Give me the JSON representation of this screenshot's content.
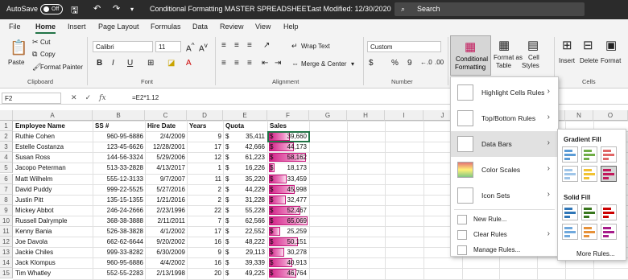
{
  "titlebar": {
    "autosave_label": "AutoSave",
    "autosave_state": "Off",
    "title": "Conditional Formatting MASTER SPREADSHEET",
    "last_modified": "Last Modified: 12/30/2020",
    "search_placeholder": "Search"
  },
  "tabs": [
    "File",
    "Home",
    "Insert",
    "Page Layout",
    "Formulas",
    "Data",
    "Review",
    "View",
    "Help"
  ],
  "ribbon": {
    "paste": "Paste",
    "cut": "Cut",
    "copy": "Copy",
    "format_painter": "Format Painter",
    "clipboard": "Clipboard",
    "font_name": "Calibri",
    "font_size": "11",
    "font_group": "Font",
    "wrap_text": "Wrap Text",
    "merge_center": "Merge & Center",
    "alignment": "Alignment",
    "number_format": "Custom",
    "number": "Number",
    "cond_fmt_1": "Conditional",
    "cond_fmt_2": "Formatting",
    "format_as_table_1": "Format as",
    "format_as_table_2": "Table",
    "cell_styles_1": "Cell",
    "cell_styles_2": "Styles",
    "insert": "Insert",
    "delete": "Delete",
    "format": "Format",
    "cells": "Cells"
  },
  "formula_bar": {
    "name_box": "F2",
    "formula": "=E2*1.12"
  },
  "columns": [
    "A",
    "B",
    "C",
    "D",
    "E",
    "F",
    "G",
    "H",
    "I",
    "J",
    "K",
    "L",
    "M",
    "N",
    "O"
  ],
  "headers": {
    "A": "Employee Name",
    "B": "SS #",
    "C": "Hire Date",
    "D": "Years",
    "E": "Quota",
    "F": "Sales"
  },
  "rows": [
    {
      "n": "2",
      "name": "Ruthie Cohen",
      "ss": "960-95-6886",
      "hire": "2/4/2009",
      "years": "9",
      "quota": "35,411",
      "sales": "39,660",
      "fill": 0.55
    },
    {
      "n": "3",
      "name": "Estelle Costanza",
      "ss": "123-45-6626",
      "hire": "12/28/2001",
      "years": "17",
      "quota": "42,666",
      "sales": "44,173",
      "fill": 0.65
    },
    {
      "n": "4",
      "name": "Susan Ross",
      "ss": "144-56-3324",
      "hire": "5/29/2006",
      "years": "12",
      "quota": "61,223",
      "sales": "58,162",
      "fill": 0.95
    },
    {
      "n": "5",
      "name": "Jacopo Peterman",
      "ss": "513-33-2828",
      "hire": "4/13/2017",
      "years": "1",
      "quota": "16,226",
      "sales": "18,173",
      "fill": 0.15
    },
    {
      "n": "6",
      "name": "Matt Wilhelm",
      "ss": "555-12-3133",
      "hire": "9/7/2007",
      "years": "11",
      "quota": "35,220",
      "sales": "33,459",
      "fill": 0.45
    },
    {
      "n": "7",
      "name": "David Puddy",
      "ss": "999-22-5525",
      "hire": "5/27/2016",
      "years": "2",
      "quota": "44,229",
      "sales": "45,998",
      "fill": 0.67
    },
    {
      "n": "8",
      "name": "Justin Pitt",
      "ss": "135-15-1355",
      "hire": "1/21/2016",
      "years": "2",
      "quota": "31,228",
      "sales": "32,477",
      "fill": 0.44
    },
    {
      "n": "9",
      "name": "Mickey Abbot",
      "ss": "246-24-2666",
      "hire": "2/23/1996",
      "years": "22",
      "quota": "55,228",
      "sales": "52,467",
      "fill": 0.82
    },
    {
      "n": "10",
      "name": "Russell Dalrymple",
      "ss": "368-38-3888",
      "hire": "2/11/2011",
      "years": "7",
      "quota": "62,566",
      "sales": "65,069",
      "fill": 1.0
    },
    {
      "n": "11",
      "name": "Kenny Bania",
      "ss": "526-38-3828",
      "hire": "4/1/2002",
      "years": "17",
      "quota": "22,552",
      "sales": "25,259",
      "fill": 0.3
    },
    {
      "n": "12",
      "name": "Joe Davola",
      "ss": "662-62-6644",
      "hire": "9/20/2002",
      "years": "16",
      "quota": "48,222",
      "sales": "50,151",
      "fill": 0.75
    },
    {
      "n": "13",
      "name": "Jackie Chiles",
      "ss": "999-33-8282",
      "hire": "6/30/2009",
      "years": "9",
      "quota": "29,113",
      "sales": "30,278",
      "fill": 0.4
    },
    {
      "n": "14",
      "name": "Jack Klompus",
      "ss": "960-95-6886",
      "hire": "4/4/2002",
      "years": "16",
      "quota": "39,339",
      "sales": "40,913",
      "fill": 0.6
    },
    {
      "n": "15",
      "name": "Tim Whatley",
      "ss": "552-55-2283",
      "hire": "2/13/1998",
      "years": "20",
      "quota": "49,225",
      "sales": "46,764",
      "fill": 0.7
    }
  ],
  "cf_menu": {
    "highlight": "Highlight Cells Rules",
    "topbottom": "Top/Bottom Rules",
    "databars": "Data Bars",
    "colorscales": "Color Scales",
    "iconsets": "Icon Sets",
    "newrule": "New Rule...",
    "clearrules": "Clear Rules",
    "managerules": "Manage Rules..."
  },
  "databars_menu": {
    "gradient": "Gradient Fill",
    "solid": "Solid Fill",
    "more": "More Rules..."
  },
  "colors": {
    "accent": "#217346",
    "bar": "#d11f86",
    "titlebar": "#2b2b2b"
  }
}
